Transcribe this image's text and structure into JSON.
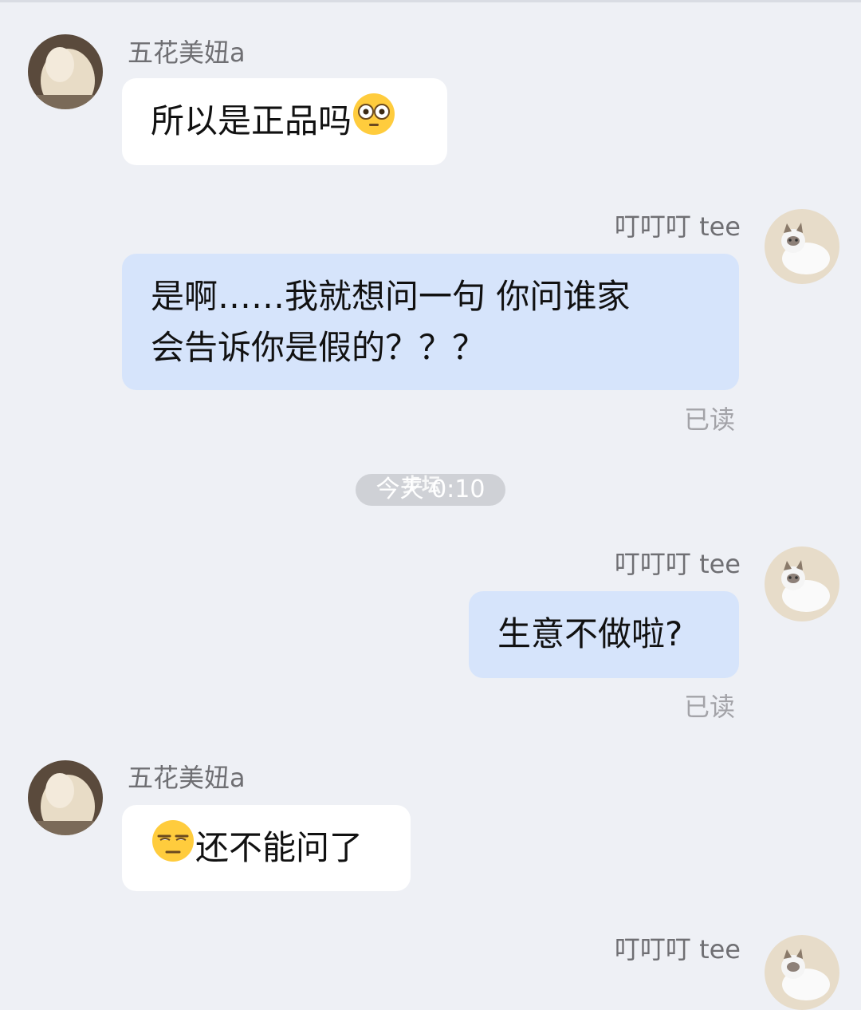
{
  "messages": [
    {
      "sender": "五花美妞a",
      "text": "所以是正品吗",
      "emoji": "flushed-face-icon"
    },
    {
      "sender": "叮叮叮 tee",
      "line1": "是啊……我就想问一句 你问谁家",
      "line2": "会告诉你是假的？？？",
      "status": "已读"
    },
    {
      "sender": "叮叮叮 tee",
      "text": "生意不做啦?",
      "status": "已读"
    },
    {
      "sender": "五花美妞a",
      "text": "还不能问了",
      "emoji": "unamused-face-icon"
    },
    {
      "sender": "叮叮叮 tee"
    }
  ],
  "timestamp": "今天 0:10",
  "watermark": "步坛",
  "colors": {
    "background": "#eef0f5",
    "incoming_bubble": "#ffffff",
    "outgoing_bubble": "#d6e4fb",
    "meta_text": "#a3a3a8"
  }
}
